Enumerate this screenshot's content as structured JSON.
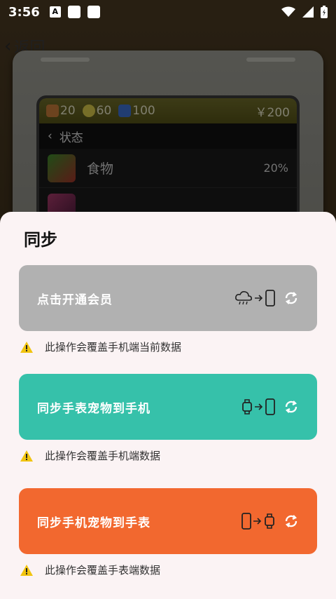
{
  "statusbar": {
    "time": "3:56"
  },
  "background": {
    "back_label": "返回",
    "stats": {
      "food": "20",
      "mood": "60",
      "health": "100",
      "money": "￥200"
    },
    "section": "状态",
    "rows": [
      {
        "label": "食物",
        "value": "20%"
      }
    ]
  },
  "sheet": {
    "title": "同步",
    "options": [
      {
        "label": "点击开通会员",
        "note": "此操作会覆盖手机端当前数据",
        "color": "#b1b1b1",
        "flow_from": "cloud-icon",
        "flow_to": "phone-icon"
      },
      {
        "label": "同步手表宠物到手机",
        "note": "此操作会覆盖手机端数据",
        "color": "#36c1aa",
        "flow_from": "watch-icon",
        "flow_to": "phone-icon"
      },
      {
        "label": "同步手机宠物到手表",
        "note": "此操作会覆盖手表端数据",
        "color": "#f2682f",
        "flow_from": "phone-icon",
        "flow_to": "watch-icon"
      }
    ]
  }
}
